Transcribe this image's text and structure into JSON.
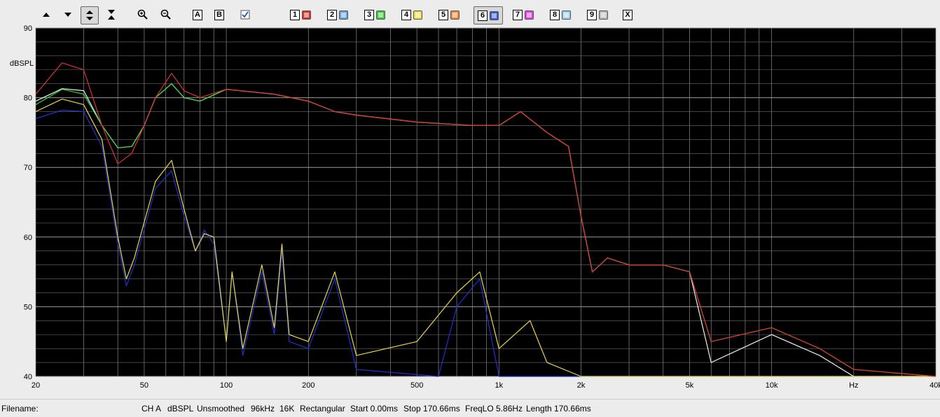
{
  "toolbar": {
    "buttons": [
      {
        "name": "arrow-up-icon"
      },
      {
        "name": "arrow-down-icon"
      },
      {
        "name": "expand-vertical-icon"
      },
      {
        "name": "collapse-vertical-icon"
      },
      {
        "name": "zoom-in-icon"
      },
      {
        "name": "zoom-out-icon"
      }
    ],
    "letters": [
      "A",
      "B"
    ],
    "overlays": [
      {
        "num": "1",
        "color": "#d9322a"
      },
      {
        "num": "2",
        "color": "#6aa2d8"
      },
      {
        "num": "3",
        "color": "#3cc83c"
      },
      {
        "num": "4",
        "color": "#e8e04a"
      },
      {
        "num": "5",
        "color": "#f08a3a"
      },
      {
        "num": "6",
        "color": "#3a5ad8"
      },
      {
        "num": "7",
        "color": "#e040e0"
      },
      {
        "num": "8",
        "color": "#9ad0ea"
      },
      {
        "num": "9",
        "color": "#bcbcbc"
      }
    ],
    "close_label": "X"
  },
  "status": {
    "filename": "Filename:",
    "channel": "CH A",
    "units": "dBSPL",
    "smoothing": "Unsmoothed",
    "rate": "96kHz",
    "fft": "16K",
    "window": "Rectangular",
    "start": "Start 0.00ms",
    "stop": "Stop 170.66ms",
    "freqlo": "FreqLO 5.86Hz",
    "length": "Length 170.66ms"
  },
  "chart_data": {
    "type": "line",
    "ylabel": "dBSPL",
    "xlabel": "Hz",
    "xscale": "log",
    "xlim": [
      20,
      40000
    ],
    "ylim": [
      40,
      90
    ],
    "yticks": [
      {
        "v": 90,
        "label": "90"
      },
      {
        "v": 80,
        "label": "80"
      },
      {
        "v": 70,
        "label": "70"
      },
      {
        "v": 60,
        "label": "60"
      },
      {
        "v": 50,
        "label": "50"
      },
      {
        "v": 40,
        "label": "40"
      }
    ],
    "xticks": [
      {
        "v": 20,
        "label": "20"
      },
      {
        "v": 50,
        "label": "50"
      },
      {
        "v": 100,
        "label": "100"
      },
      {
        "v": 200,
        "label": "200"
      },
      {
        "v": 500,
        "label": "500"
      },
      {
        "v": 1000,
        "label": "1k"
      },
      {
        "v": 2000,
        "label": "2k"
      },
      {
        "v": 5000,
        "label": "5k"
      },
      {
        "v": 10000,
        "label": "10k"
      },
      {
        "v": 20000,
        "label": "Hz"
      },
      {
        "v": 40000,
        "label": "40k"
      }
    ],
    "grid": true,
    "background": "#000000",
    "series": [
      {
        "color": "#2030d0",
        "points": [
          [
            20,
            77
          ],
          [
            25,
            78.2
          ],
          [
            30,
            78
          ],
          [
            35,
            73
          ],
          [
            40,
            59
          ],
          [
            43,
            53
          ],
          [
            46,
            56
          ],
          [
            55,
            67
          ],
          [
            63,
            69.5
          ],
          [
            70,
            63
          ],
          [
            77,
            58
          ],
          [
            83,
            61
          ],
          [
            90,
            59
          ],
          [
            100,
            45
          ],
          [
            105,
            55
          ],
          [
            115,
            43
          ],
          [
            135,
            55
          ],
          [
            150,
            46
          ],
          [
            160,
            58
          ],
          [
            170,
            45
          ],
          [
            200,
            44
          ],
          [
            250,
            54
          ],
          [
            300,
            41
          ],
          [
            600,
            40
          ],
          [
            700,
            50
          ],
          [
            850,
            54
          ],
          [
            1000,
            40
          ],
          [
            2000,
            40
          ],
          [
            40000,
            40
          ]
        ]
      },
      {
        "color": "#f0f0f0",
        "points": [
          [
            20,
            79.5
          ],
          [
            25,
            81.3
          ],
          [
            30,
            81
          ],
          [
            35,
            76
          ],
          [
            40,
            72.8
          ],
          [
            45,
            73
          ],
          [
            50,
            76
          ],
          [
            55,
            80
          ],
          [
            63,
            82
          ],
          [
            70,
            80
          ],
          [
            80,
            79.5
          ],
          [
            100,
            81.2
          ],
          [
            150,
            80.5
          ],
          [
            200,
            79.5
          ],
          [
            250,
            78
          ],
          [
            300,
            77.5
          ],
          [
            500,
            76.5
          ],
          [
            800,
            76
          ],
          [
            1000,
            76
          ],
          [
            1200,
            78
          ],
          [
            1500,
            75
          ],
          [
            1800,
            73
          ],
          [
            2000,
            63
          ],
          [
            2200,
            55
          ],
          [
            2500,
            57
          ],
          [
            3000,
            56
          ],
          [
            4000,
            56
          ],
          [
            5000,
            55
          ],
          [
            6000,
            42
          ],
          [
            10000,
            46
          ],
          [
            15000,
            43
          ],
          [
            20000,
            40
          ],
          [
            40000,
            40
          ]
        ]
      },
      {
        "color": "#e8d84a",
        "points": [
          [
            20,
            78
          ],
          [
            25,
            79.8
          ],
          [
            30,
            79
          ],
          [
            35,
            74
          ],
          [
            40,
            60
          ],
          [
            43,
            54
          ],
          [
            46,
            57
          ],
          [
            55,
            68
          ],
          [
            63,
            71
          ],
          [
            70,
            64
          ],
          [
            77,
            58
          ],
          [
            83,
            60.5
          ],
          [
            90,
            60
          ],
          [
            100,
            45
          ],
          [
            105,
            55
          ],
          [
            115,
            44
          ],
          [
            135,
            56
          ],
          [
            150,
            47
          ],
          [
            160,
            59
          ],
          [
            170,
            46
          ],
          [
            200,
            45
          ],
          [
            250,
            55
          ],
          [
            300,
            43
          ],
          [
            500,
            45
          ],
          [
            700,
            52
          ],
          [
            850,
            55
          ],
          [
            1000,
            44
          ],
          [
            1300,
            48
          ],
          [
            1500,
            42
          ],
          [
            2000,
            40
          ],
          [
            40000,
            40
          ]
        ]
      },
      {
        "color": "#3ad83a",
        "points": [
          [
            20,
            79
          ],
          [
            25,
            81.2
          ],
          [
            30,
            80.5
          ],
          [
            35,
            76
          ],
          [
            40,
            72.8
          ],
          [
            45,
            73
          ],
          [
            50,
            76
          ],
          [
            55,
            80
          ],
          [
            63,
            82
          ],
          [
            70,
            80
          ],
          [
            80,
            79.5
          ],
          [
            100,
            81.2
          ],
          [
            150,
            80.5
          ],
          [
            200,
            79.5
          ],
          [
            250,
            78
          ],
          [
            300,
            77.5
          ],
          [
            500,
            76.5
          ],
          [
            800,
            76
          ],
          [
            1000,
            76
          ],
          [
            1200,
            78
          ],
          [
            1500,
            75
          ],
          [
            1800,
            73
          ],
          [
            2000,
            63
          ],
          [
            2200,
            55
          ],
          [
            2500,
            57
          ],
          [
            3000,
            56
          ],
          [
            4000,
            56
          ],
          [
            5000,
            55
          ],
          [
            6000,
            45
          ],
          [
            10000,
            47
          ],
          [
            15000,
            44
          ],
          [
            20000,
            41
          ],
          [
            40000,
            40
          ]
        ]
      },
      {
        "color": "#e03030",
        "points": [
          [
            20,
            80.5
          ],
          [
            25,
            85
          ],
          [
            30,
            84
          ],
          [
            35,
            76
          ],
          [
            40,
            70.5
          ],
          [
            45,
            72
          ],
          [
            50,
            76
          ],
          [
            55,
            80
          ],
          [
            63,
            83.5
          ],
          [
            70,
            81
          ],
          [
            80,
            80
          ],
          [
            100,
            81.2
          ],
          [
            150,
            80.5
          ],
          [
            200,
            79.5
          ],
          [
            250,
            78
          ],
          [
            300,
            77.5
          ],
          [
            500,
            76.5
          ],
          [
            800,
            76
          ],
          [
            1000,
            76
          ],
          [
            1200,
            78
          ],
          [
            1500,
            75
          ],
          [
            1800,
            73
          ],
          [
            2000,
            63
          ],
          [
            2200,
            55
          ],
          [
            2500,
            57
          ],
          [
            3000,
            56
          ],
          [
            4000,
            56
          ],
          [
            5000,
            55
          ],
          [
            6000,
            45
          ],
          [
            10000,
            47
          ],
          [
            15000,
            44
          ],
          [
            20000,
            41
          ],
          [
            40000,
            40
          ]
        ]
      }
    ]
  }
}
